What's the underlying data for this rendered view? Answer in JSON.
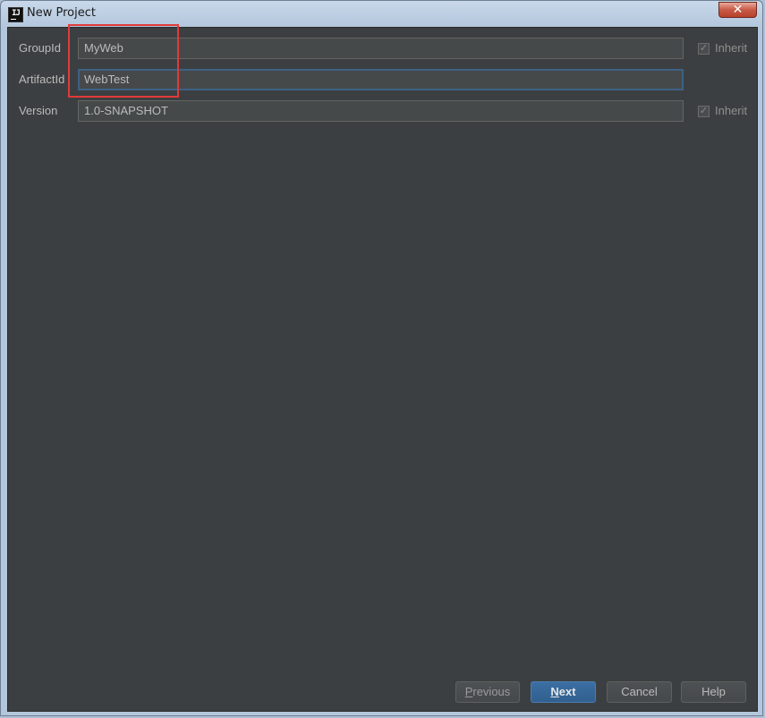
{
  "window": {
    "title": "New Project",
    "app_icon_text": "IJ",
    "close_symbol": "✕"
  },
  "form": {
    "group_id": {
      "label": "GroupId",
      "value": "MyWeb",
      "inherit_label": "Inherit",
      "inherit_checked": true
    },
    "artifact_id": {
      "label": "ArtifactId",
      "value": "WebTest"
    },
    "version": {
      "label": "Version",
      "value": "1.0-SNAPSHOT",
      "inherit_label": "Inherit",
      "inherit_checked": true
    }
  },
  "buttons": {
    "previous": "Previous",
    "next": "Next",
    "cancel": "Cancel",
    "help": "Help"
  },
  "colors": {
    "dialog_background": "#3c3f41",
    "accent": "#365880",
    "highlight_annotation": "#e03a3a"
  }
}
